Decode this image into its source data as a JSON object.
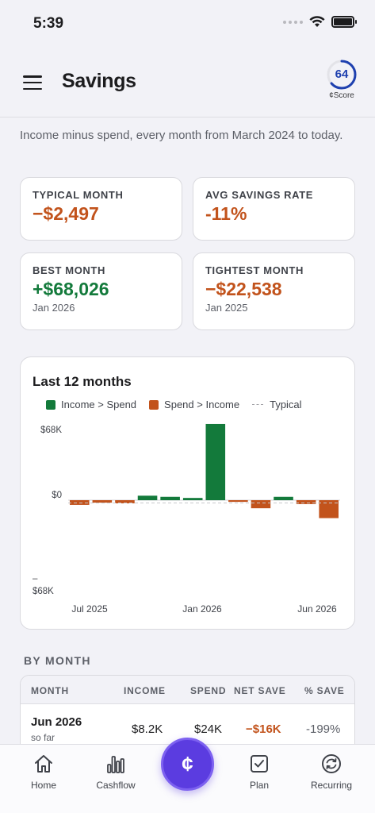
{
  "status_bar": {
    "time": "5:39"
  },
  "header": {
    "title": "Savings",
    "score_value": "64",
    "score_label": "¢Score"
  },
  "intro": "Income minus spend, every month from March 2024 to today.",
  "stats": [
    {
      "label": "TYPICAL MONTH",
      "value": "−$2,497",
      "tone": "negative"
    },
    {
      "label": "AVG SAVINGS RATE",
      "value": "-11%",
      "tone": "negative"
    },
    {
      "label": "BEST MONTH",
      "value": "+$68,026",
      "sub": "Jan 2026",
      "tone": "positive"
    },
    {
      "label": "TIGHTEST MONTH",
      "value": "−$22,538",
      "sub": "Jan 2025",
      "tone": "negative"
    }
  ],
  "chart_data": {
    "type": "bar",
    "title": "Last 12 months",
    "legend": [
      {
        "label": "Income > Spend",
        "color": "#137a3b"
      },
      {
        "label": "Spend > Income",
        "color": "#c2531c"
      },
      {
        "label": "Typical",
        "style": "dashed"
      }
    ],
    "y_tick_labels": [
      "$68K",
      "$0",
      "–\n$68K"
    ],
    "x_tick_labels": [
      "Jul 2025",
      "Jan 2026",
      "Jun 2026"
    ],
    "ylim": [
      -68000,
      68000
    ],
    "typical": -2497,
    "categories": [
      "Jul 2025",
      "Aug 2025",
      "Sep 2025",
      "Oct 2025",
      "Nov 2025",
      "Dec 2025",
      "Jan 2026",
      "Feb 2026",
      "Mar 2026",
      "Apr 2026",
      "May 2026",
      "Jun 2026"
    ],
    "values": [
      -4200,
      -2200,
      -2800,
      4000,
      3000,
      2000,
      68026,
      -1500,
      -7200,
      3000,
      -3500,
      -16000
    ],
    "colors": {
      "positive": "#137a3b",
      "negative": "#c2531c"
    }
  },
  "by_month": {
    "heading": "BY MONTH",
    "columns": [
      "MONTH",
      "INCOME",
      "SPEND",
      "NET SAVE",
      "% SAVE"
    ],
    "rows": [
      {
        "month": "Jun 2026",
        "note": "so far",
        "income": "$8.2K",
        "spend": "$24K",
        "net": "−$16K",
        "pct": "-199%"
      }
    ]
  },
  "tab_bar": {
    "tabs": [
      {
        "label": "Home",
        "icon": "home-icon"
      },
      {
        "label": "Cashflow",
        "icon": "bar-chart-icon"
      },
      {
        "label": "Plan",
        "icon": "checkbox-icon"
      },
      {
        "label": "Recurring",
        "icon": "refresh-icon"
      }
    ],
    "center_glyph": "¢"
  }
}
